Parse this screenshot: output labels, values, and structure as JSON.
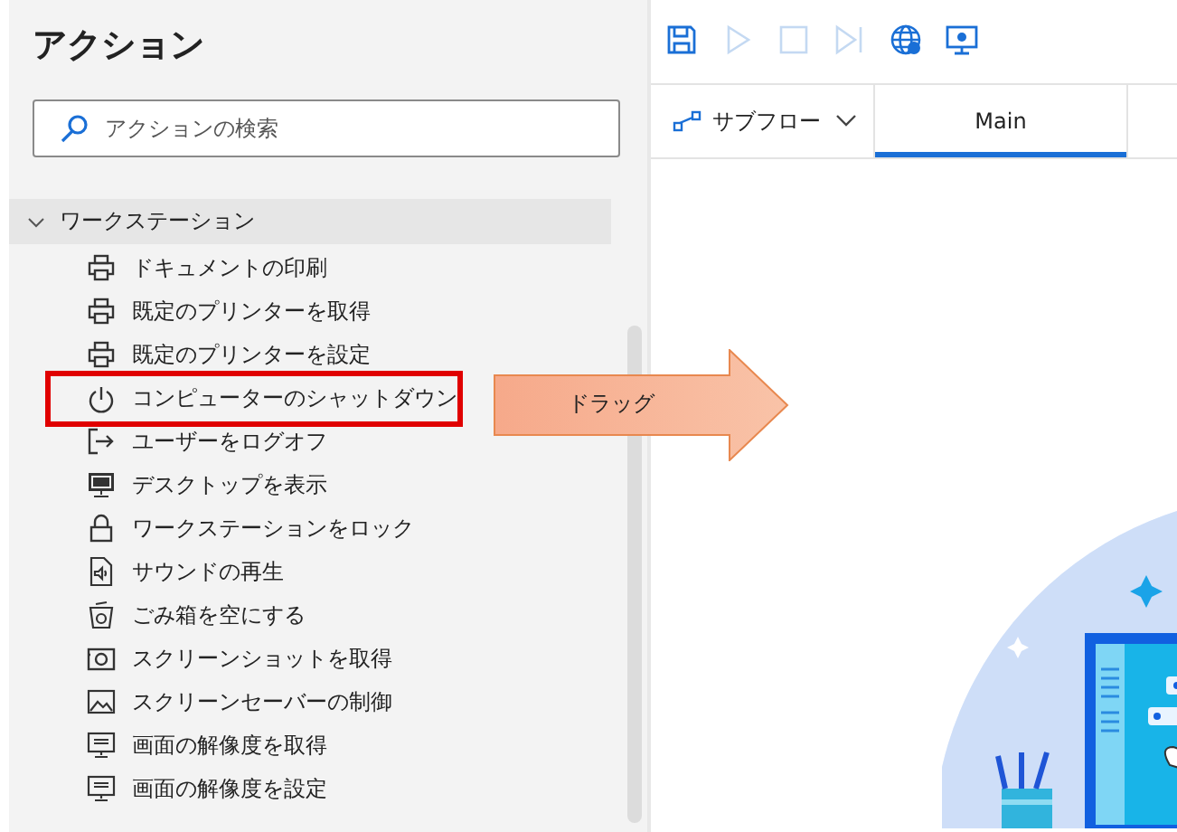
{
  "actions_panel": {
    "title": "アクション",
    "search": {
      "placeholder": "アクションの検索"
    },
    "group": {
      "label": "ワークステーション",
      "expanded": true,
      "items": [
        {
          "label": "ドキュメントの印刷",
          "kind": "printer",
          "highlighted": false
        },
        {
          "label": "既定のプリンターを取得",
          "kind": "printer",
          "highlighted": false
        },
        {
          "label": "既定のプリンターを設定",
          "kind": "printer",
          "highlighted": false
        },
        {
          "label": "コンピューターのシャットダウン",
          "kind": "power",
          "highlighted": true
        },
        {
          "label": "ユーザーをログオフ",
          "kind": "logoff",
          "highlighted": false
        },
        {
          "label": "デスクトップを表示",
          "kind": "desktop",
          "highlighted": false
        },
        {
          "label": "ワークステーションをロック",
          "kind": "lock",
          "highlighted": false
        },
        {
          "label": "サウンドの再生",
          "kind": "sound",
          "highlighted": false
        },
        {
          "label": "ごみ箱を空にする",
          "kind": "bin",
          "highlighted": false
        },
        {
          "label": "スクリーンショットを取得",
          "kind": "camera",
          "highlighted": false
        },
        {
          "label": "スクリーンセーバーの制御",
          "kind": "picture",
          "highlighted": false
        },
        {
          "label": "画面の解像度を取得",
          "kind": "display",
          "highlighted": false
        },
        {
          "label": "画面の解像度を設定",
          "kind": "display",
          "highlighted": false
        }
      ]
    }
  },
  "callout": {
    "text": "ドラッグ"
  },
  "designer": {
    "toolbar": [
      {
        "kind": "save",
        "disabled": false
      },
      {
        "kind": "run",
        "disabled": true
      },
      {
        "kind": "stop",
        "disabled": true
      },
      {
        "kind": "step",
        "disabled": true
      },
      {
        "kind": "web",
        "disabled": false
      },
      {
        "kind": "desktop",
        "disabled": false
      }
    ],
    "subflows": {
      "label": "サブフロー"
    },
    "tabs": [
      {
        "label": "Main",
        "selected": true
      }
    ]
  }
}
